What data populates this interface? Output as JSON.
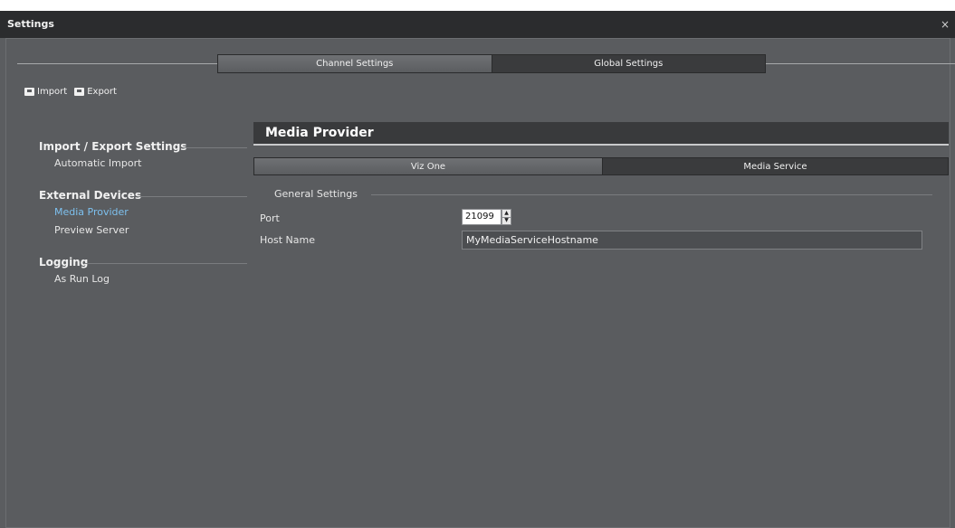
{
  "window": {
    "title": "Settings",
    "close_glyph": "×"
  },
  "top_tabs": [
    {
      "label": "Channel Settings",
      "active": false
    },
    {
      "label": "Global Settings",
      "active": true
    }
  ],
  "toolbar": {
    "import_label": "Import",
    "export_label": "Export",
    "import_icon": "import-icon",
    "export_icon": "export-icon"
  },
  "sidebar": {
    "sections": [
      {
        "title": "Import / Export Settings",
        "items": [
          {
            "label": "Automatic Import",
            "selected": false
          }
        ]
      },
      {
        "title": "External Devices",
        "items": [
          {
            "label": "Media Provider",
            "selected": true
          },
          {
            "label": "Preview Server",
            "selected": false
          }
        ]
      },
      {
        "title": "Logging",
        "items": [
          {
            "label": "As Run Log",
            "selected": false
          }
        ]
      }
    ]
  },
  "panel": {
    "title": "Media Provider",
    "sub_tabs": [
      {
        "label": "Viz One",
        "active": false
      },
      {
        "label": "Media Service",
        "active": true
      }
    ],
    "group_title": "General Settings",
    "port_label": "Port",
    "port_value": "21099",
    "host_label": "Host Name",
    "host_value": "MyMediaServiceHostname"
  },
  "colors": {
    "selected_item": "#7dc0ee",
    "background": "#5a5c5f",
    "titlebar": "#2b2c2e"
  }
}
